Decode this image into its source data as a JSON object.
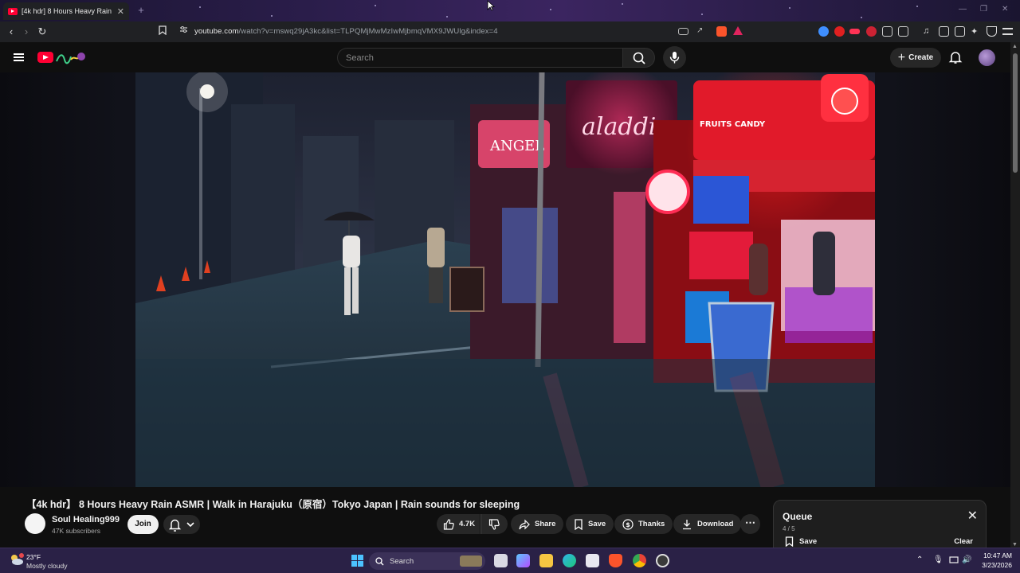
{
  "browser": {
    "tab_title": "[4k hdr] 8 Hours Heavy Rain",
    "url_domain": "youtube.com",
    "url_rest": "/watch?v=mswq29jA3kc&list=TLPQMjMwMzIwMjbmqVMX9JWUlg&index=4"
  },
  "masthead": {
    "search_placeholder": "Search",
    "create_label": "Create"
  },
  "video": {
    "title": "【4k hdr】 8 Hours Heavy Rain ASMR | Walk in Harajuku（原宿）Tokyo Japan | Rain sounds for sleeping",
    "scene_signs": {
      "aladdin": "aladdin",
      "fruits": "FRUITS CANDY",
      "angel": "ANGEL"
    }
  },
  "channel": {
    "name": "Soul Healing999",
    "subscribers": "47K subscribers",
    "join_label": "Join"
  },
  "actions": {
    "likes": "4.7K",
    "share": "Share",
    "save": "Save",
    "thanks": "Thanks",
    "download": "Download"
  },
  "queue": {
    "title": "Queue",
    "count": "4 / 5",
    "save_label": "Save",
    "clear_label": "Clear"
  },
  "taskbar": {
    "temperature": "23°F",
    "condition": "Mostly cloudy",
    "search_label": "Search",
    "time": "10:47 AM",
    "date": "3/23/2026"
  },
  "colors": {
    "youtube_red": "#ff0033",
    "background": "#0f0f0f",
    "taskbar": "#2a2146"
  }
}
